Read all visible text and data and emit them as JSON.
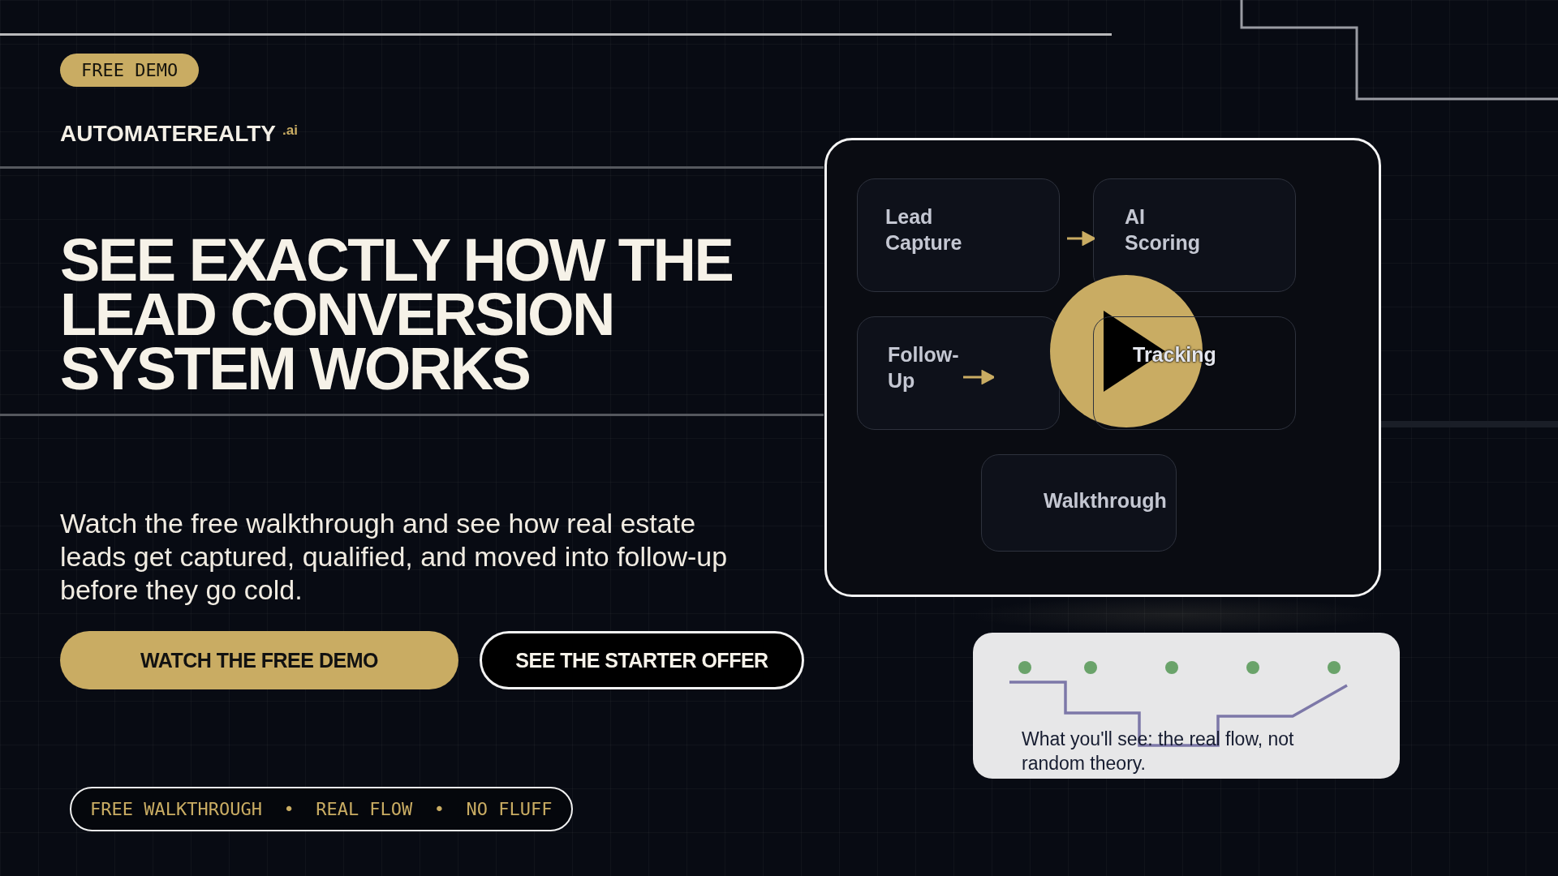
{
  "badge": "FREE DEMO",
  "brand": {
    "name": "AUTOMATEREALTY",
    "suffix": ".ai"
  },
  "headline": "SEE EXACTLY HOW THE LEAD CONVERSION SYSTEM WORKS",
  "description": "Watch the free walkthrough and see how real estate leads get captured, qualified, and moved into follow-up before they go cold.",
  "buttons": [
    {
      "label": "WATCH THE FREE DEMO",
      "kind": "primary"
    },
    {
      "label": "SEE THE STARTER OFFER",
      "kind": "secondary"
    }
  ],
  "tagline": "FREE WALKTHROUGH  •  REAL FLOW  •  NO FLUFF",
  "diagram": {
    "nodes": [
      {
        "label": "Lead Capture"
      },
      {
        "label": "AI Scoring"
      },
      {
        "label": "Follow-Up"
      },
      {
        "label": "Tracking"
      },
      {
        "label": "Walkthrough"
      }
    ]
  },
  "caption": "What you'll see: the real flow, not random theory."
}
